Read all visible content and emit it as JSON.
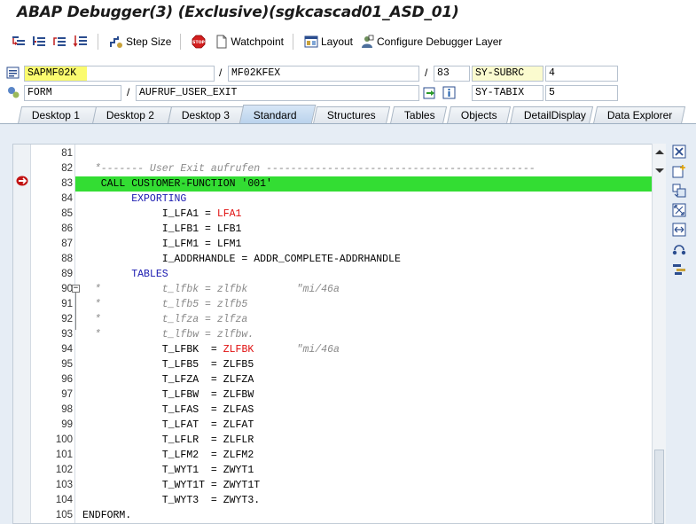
{
  "title": "ABAP Debugger(3)  (Exclusive)(sgkcascad01_ASD_01)",
  "toolbar": {
    "step_size": "Step Size",
    "watchpoint": "Watchpoint",
    "layout": "Layout",
    "configure": "Configure Debugger Layer"
  },
  "fields": {
    "program": "SAPMF02K",
    "include": "MF02KFEX",
    "line": "83",
    "sysubrc_label": "SY-SUBRC",
    "sysubrc_value": "4",
    "event_type": "FORM",
    "event_name": "AUFRUF_USER_EXIT",
    "sytabix_label": "SY-TABIX",
    "sytabix_value": "5"
  },
  "tabs": [
    "Desktop 1",
    "Desktop 2",
    "Desktop 3",
    "Standard",
    "Structures",
    "Tables",
    "Objects",
    "DetailDisplay",
    "Data Explorer"
  ],
  "active_tab": "Standard",
  "colors": {
    "highlight": "#33dd33",
    "program_highlight": "#fbfb6e",
    "keyword": "#1a1ab0",
    "red": "#e01010",
    "comment": "#8a8a8a"
  },
  "code": {
    "current_line": 83,
    "lines": [
      {
        "no": "81",
        "parts": []
      },
      {
        "no": "82",
        "parts": [
          {
            "t": "  *------- User Exit aufrufen --------------------------------------------",
            "c": "cm"
          }
        ]
      },
      {
        "no": "83",
        "parts": [
          {
            "t": "   CALL CUSTOMER-FUNCTION '001'",
            "c": ""
          }
        ]
      },
      {
        "no": "84",
        "parts": [
          {
            "t": "        ",
            "c": ""
          },
          {
            "t": "EXPORTING",
            "c": "kw"
          }
        ]
      },
      {
        "no": "85",
        "parts": [
          {
            "t": "             I_LFA1 = ",
            "c": ""
          },
          {
            "t": "LFA1",
            "c": "red"
          }
        ]
      },
      {
        "no": "86",
        "parts": [
          {
            "t": "             I_LFB1 = LFB1",
            "c": ""
          }
        ]
      },
      {
        "no": "87",
        "parts": [
          {
            "t": "             I_LFM1 = LFM1",
            "c": ""
          }
        ]
      },
      {
        "no": "88",
        "parts": [
          {
            "t": "             I_ADDRHANDLE = ADDR_COMPLETE-ADDRHANDLE",
            "c": ""
          }
        ]
      },
      {
        "no": "89",
        "parts": [
          {
            "t": "        ",
            "c": ""
          },
          {
            "t": "TABLES",
            "c": "kw"
          }
        ]
      },
      {
        "no": "90",
        "parts": [
          {
            "t": "  *          t_lfbk = zlfbk        \"mi/46a",
            "c": "cm"
          }
        ]
      },
      {
        "no": "91",
        "parts": [
          {
            "t": "  *          t_lfb5 = zlfb5",
            "c": "cm"
          }
        ]
      },
      {
        "no": "92",
        "parts": [
          {
            "t": "  *          t_lfza = zlfza",
            "c": "cm"
          }
        ]
      },
      {
        "no": "93",
        "parts": [
          {
            "t": "  *          t_lfbw = zlfbw.",
            "c": "cm"
          }
        ]
      },
      {
        "no": "94",
        "parts": [
          {
            "t": "             T_LFBK  = ",
            "c": ""
          },
          {
            "t": "ZLFBK",
            "c": "red"
          },
          {
            "t": "       \"mi/46a",
            "c": "cm"
          }
        ]
      },
      {
        "no": "95",
        "parts": [
          {
            "t": "             T_LFB5  = ZLFB5",
            "c": ""
          }
        ]
      },
      {
        "no": "96",
        "parts": [
          {
            "t": "             T_LFZA  = ZLFZA",
            "c": ""
          }
        ]
      },
      {
        "no": "97",
        "parts": [
          {
            "t": "             T_LFBW  = ZLFBW",
            "c": ""
          }
        ]
      },
      {
        "no": "98",
        "parts": [
          {
            "t": "             T_LFAS  = ZLFAS",
            "c": ""
          }
        ]
      },
      {
        "no": "99",
        "parts": [
          {
            "t": "             T_LFAT  = ZLFAT",
            "c": ""
          }
        ]
      },
      {
        "no": "100",
        "parts": [
          {
            "t": "             T_LFLR  = ZLFLR",
            "c": ""
          }
        ]
      },
      {
        "no": "101",
        "parts": [
          {
            "t": "             T_LFM2  = ZLFM2",
            "c": ""
          }
        ]
      },
      {
        "no": "102",
        "parts": [
          {
            "t": "             T_WYT1  = ZWYT1",
            "c": ""
          }
        ]
      },
      {
        "no": "103",
        "parts": [
          {
            "t": "             T_WYT1T = ZWYT1T",
            "c": ""
          }
        ]
      },
      {
        "no": "104",
        "parts": [
          {
            "t": "             T_WYT3  = ZWYT3.",
            "c": ""
          }
        ]
      },
      {
        "no": "105",
        "parts": [
          {
            "t": "ENDFORM.",
            "c": ""
          }
        ]
      }
    ]
  }
}
